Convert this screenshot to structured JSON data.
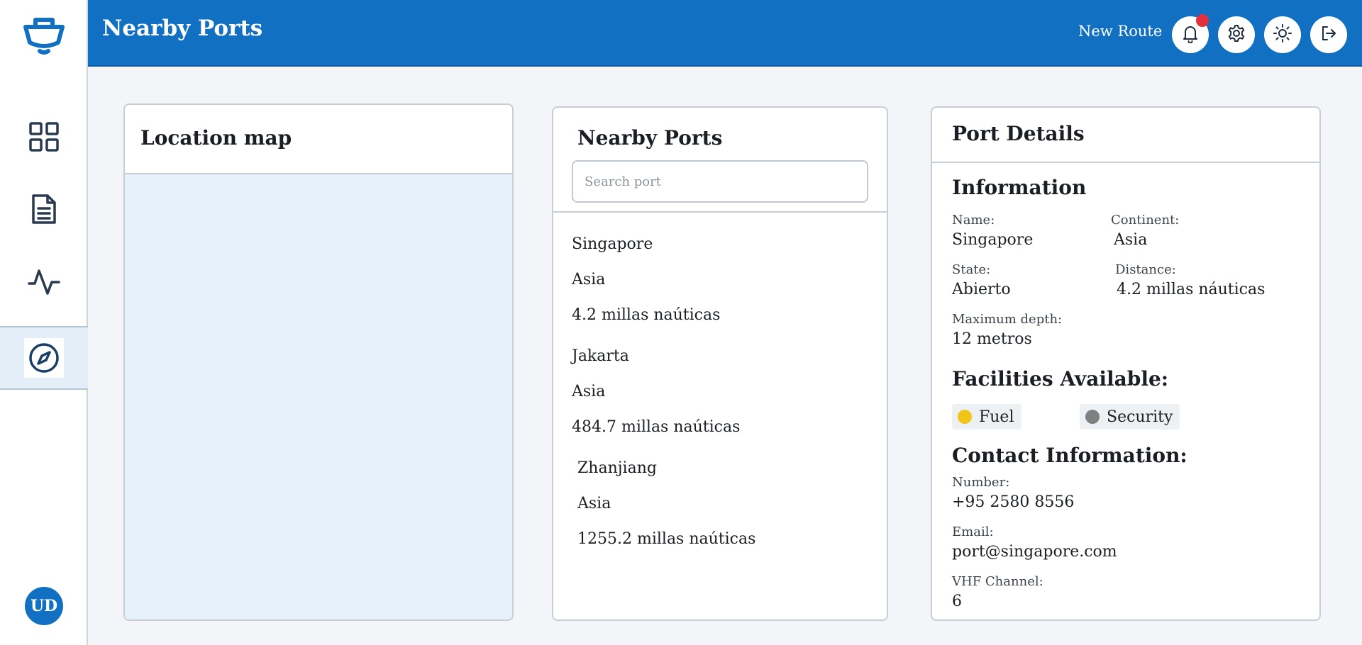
{
  "header": {
    "title": "Nearby Ports",
    "new_route_label": "New Route",
    "notification_color": "#e0313c",
    "brand_color": "#1270c2"
  },
  "sidebar": {
    "items": [
      {
        "icon": "dashboard-grid-icon"
      },
      {
        "icon": "document-icon"
      },
      {
        "icon": "activity-icon"
      },
      {
        "icon": "compass-icon",
        "active": true
      }
    ],
    "avatar_initials": "UD"
  },
  "map_panel": {
    "title": "Location map"
  },
  "ports_panel": {
    "title": "Nearby Ports",
    "search_placeholder": "Search port",
    "ports": [
      {
        "name": "Singapore",
        "continent": "Asia",
        "distance": "4.2 millas naúticas"
      },
      {
        "name": "Jakarta",
        "continent": "Asia",
        "distance": "484.7 millas naúticas"
      },
      {
        "name": "Zhanjiang",
        "continent": "Asia",
        "distance": "1255.2 millas naúticas"
      }
    ]
  },
  "details_panel": {
    "title": "Port Details",
    "information_title": "Information",
    "name_label": "Name:",
    "name_value": "Singapore",
    "continent_label": "Continent:",
    "continent_value": "Asia",
    "state_label": "State:",
    "state_value": "Abierto",
    "distance_label": "Distance:",
    "distance_value": "4.2 millas náuticas",
    "depth_label": "Maximum depth:",
    "depth_value": "12 metros",
    "facilities_title": "Facilities Available:",
    "facilities": [
      {
        "label": "Fuel",
        "color": "#f0c419"
      },
      {
        "label": "Security",
        "color": "#808080"
      }
    ],
    "contact_title": "Contact Information:",
    "number_label": "Number:",
    "number_value": "+95 2580 8556",
    "email_label": "Email:",
    "email_value": "port@singapore.com",
    "vhf_label": "VHF Channel:",
    "vhf_value": "6"
  }
}
